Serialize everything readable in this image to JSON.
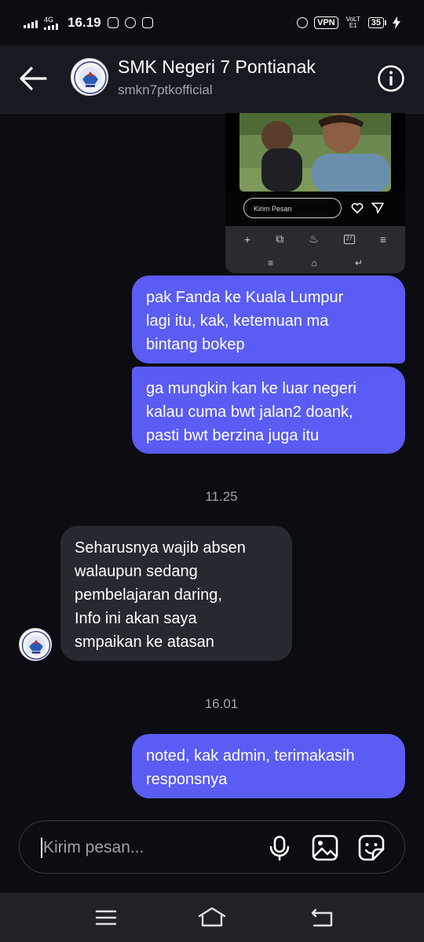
{
  "status_bar": {
    "network": "4G",
    "time": "16.19",
    "vpn": "VPN",
    "volte": "VoLTE1",
    "battery": "35"
  },
  "header": {
    "title": "SMK Negeri 7 Pontianak",
    "username": "smkn7ptkofficial",
    "back_icon": "arrow-left-icon",
    "info_icon": "info-icon"
  },
  "shared_media": {
    "input_placeholder": "Kirim Pesan",
    "tab_count": "27",
    "icons": [
      "heart-icon",
      "send-icon",
      "plus-icon",
      "copy-icon",
      "flame-icon",
      "tabs-icon",
      "menu-icon"
    ]
  },
  "messages": [
    {
      "direction": "outgoing",
      "text": "pak Fanda ke Kuala Lumpur\nlagi itu, kak, ketemuan ma\nbintang bokep"
    },
    {
      "direction": "outgoing",
      "text": "ga mungkin kan ke luar negeri\nkalau cuma bwt jalan2 doank,\npasti bwt berzina juga itu"
    },
    {
      "type": "timestamp",
      "text": "11.25"
    },
    {
      "direction": "incoming",
      "text": "Seharusnya wajib absen\nwalaupun sedang\npembelajaran daring,\nInfo ini akan saya\nsmpaikan ke atasan"
    },
    {
      "type": "timestamp",
      "text": "16.01"
    },
    {
      "direction": "outgoing",
      "text": "noted, kak admin, terimakasih\nresponsnya"
    }
  ],
  "composer": {
    "placeholder": "Kirim pesan...",
    "icons": [
      "microphone-icon",
      "image-icon",
      "sticker-icon"
    ]
  },
  "colors": {
    "background": "#0b0d12",
    "header": "#171a21",
    "outgoing_bubble": "#5a5cf4",
    "incoming_bubble": "#26292f",
    "muted_text": "#a0a4ab"
  }
}
